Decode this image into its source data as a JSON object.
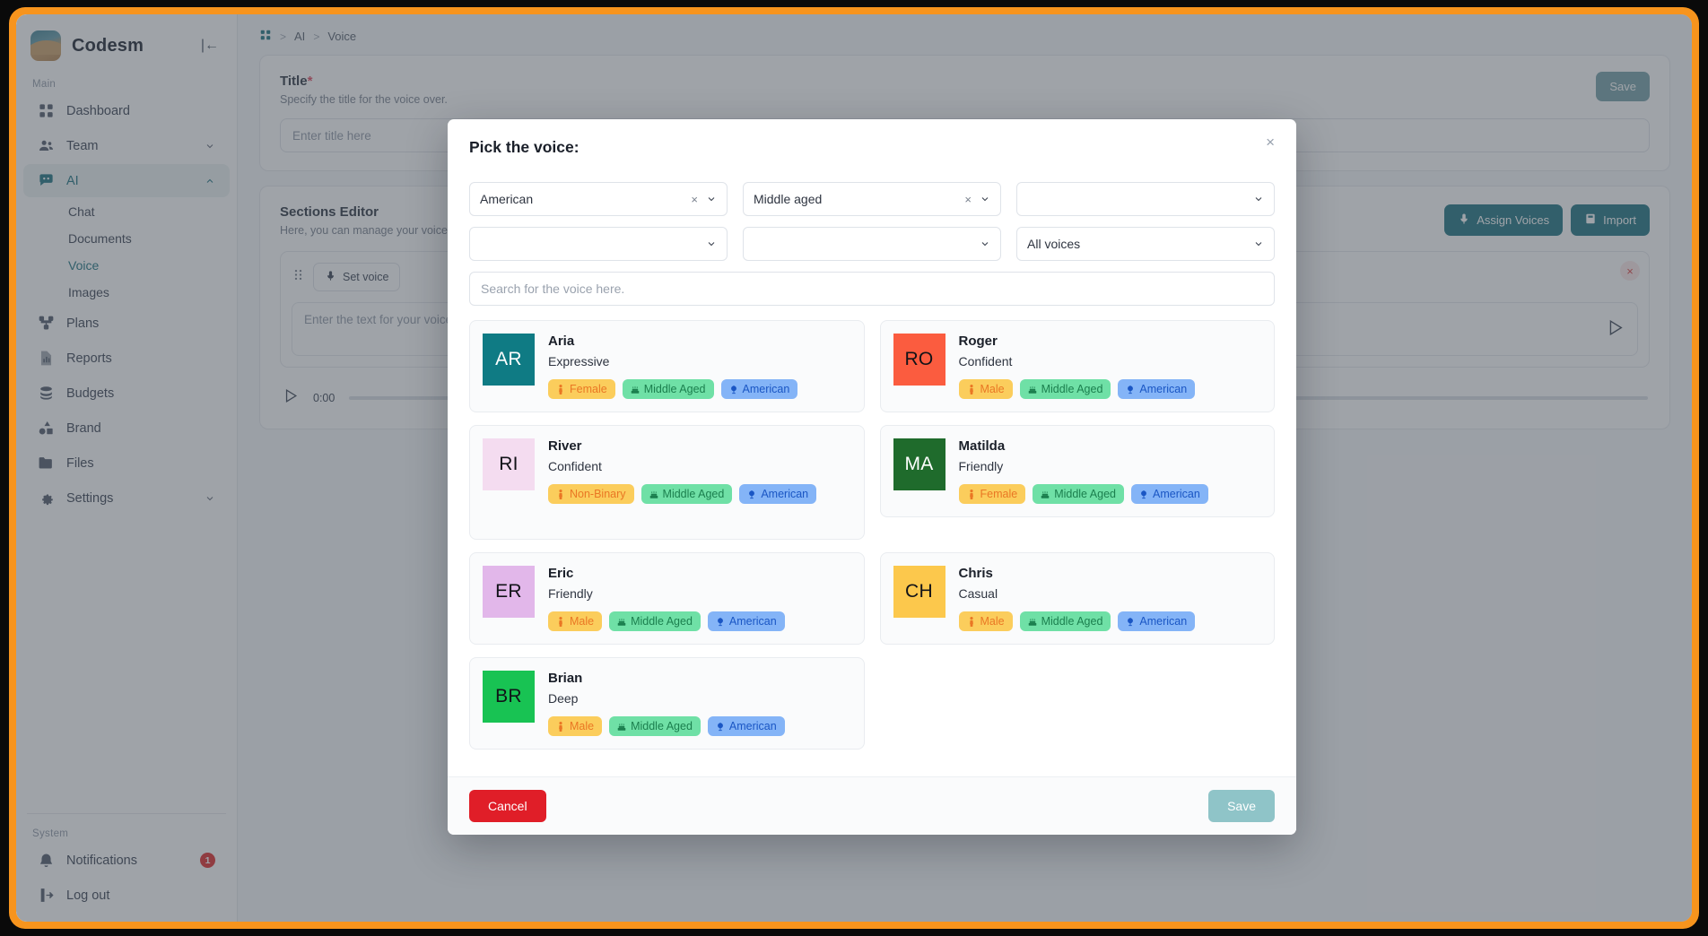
{
  "colors": {
    "frame_orange": "#f7941d",
    "brand_teal": "#2e7d8a",
    "danger_red": "#e01e28",
    "tag_gender_bg": "#fbcd5c",
    "tag_gender_fg": "#ea7724",
    "tag_age_bg": "#6fe0a6",
    "tag_age_fg": "#1b7f4e",
    "tag_accent_bg": "#84b4f7",
    "tag_accent_fg": "#1a56c4"
  },
  "sidebar": {
    "brand": "Codesm",
    "collapse_icon": "collapse-panel-icon",
    "section_main": "Main",
    "section_system": "System",
    "items": [
      {
        "label": "Dashboard",
        "icon": "dashboard-icon",
        "expandable": false
      },
      {
        "label": "Team",
        "icon": "team-icon",
        "expandable": true
      },
      {
        "label": "AI",
        "icon": "chat-ai-icon",
        "expandable": true,
        "expanded": true,
        "active": true
      },
      {
        "label": "Plans",
        "icon": "plans-icon",
        "expandable": false
      },
      {
        "label": "Reports",
        "icon": "reports-icon",
        "expandable": false
      },
      {
        "label": "Budgets",
        "icon": "budgets-icon",
        "expandable": false
      },
      {
        "label": "Brand",
        "icon": "brand-icon",
        "expandable": false
      },
      {
        "label": "Files",
        "icon": "files-icon",
        "expandable": false
      },
      {
        "label": "Settings",
        "icon": "gear-icon",
        "expandable": true
      }
    ],
    "ai_children": [
      {
        "label": "Chat",
        "current": false
      },
      {
        "label": "Documents",
        "current": false
      },
      {
        "label": "Voice",
        "current": true
      },
      {
        "label": "Images",
        "current": false
      }
    ],
    "system_items": [
      {
        "label": "Notifications",
        "icon": "bell-icon",
        "badge": "1"
      },
      {
        "label": "Log out",
        "icon": "logout-icon",
        "badge": ""
      }
    ]
  },
  "breadcrumb": {
    "home_icon": "dashboard-icon",
    "items": [
      "AI",
      "Voice"
    ],
    "separator": ">"
  },
  "main": {
    "save_label": "Save",
    "title_label": "Title",
    "title_required_mark": "*",
    "title_hint": "Specify the title for the voice over.",
    "title_placeholder": "Enter title here",
    "sections_label": "Sections Editor",
    "sections_hint": "Here, you can manage your voice over sections.",
    "assign_voices_label": "Assign Voices",
    "assign_voices_icon": "microphone-icon",
    "import_label": "Import",
    "import_icon": "import-file-icon",
    "set_voice_label": "Set voice",
    "set_voice_icon": "microphone-icon",
    "grip_icon": "drag-grip-icon",
    "row_close_icon": "close-icon",
    "text_placeholder": "Enter the text for your voice over here.",
    "audio_time": "0:00",
    "play_icon": "play-icon"
  },
  "modal": {
    "title": "Pick the voice:",
    "close_icon": "close-icon",
    "filters": [
      {
        "name": "accent-filter",
        "value": "American",
        "clearable": true,
        "clear_glyph": "×"
      },
      {
        "name": "age-filter",
        "value": "Middle aged",
        "clearable": true,
        "clear_glyph": "×"
      },
      {
        "name": "gender-filter",
        "value": "",
        "clearable": false,
        "clear_glyph": ""
      },
      {
        "name": "use-case-filter",
        "value": "",
        "clearable": false,
        "clear_glyph": ""
      },
      {
        "name": "language-filter",
        "value": "",
        "clearable": false,
        "clear_glyph": ""
      },
      {
        "name": "library-filter",
        "value": "All voices",
        "clearable": false,
        "clear_glyph": ""
      }
    ],
    "search_placeholder": "Search for the voice here.",
    "search_value": "",
    "voices": [
      {
        "name": "Aria",
        "style": "Expressive",
        "initials": "AR",
        "avatar_bg": "#0f7b84",
        "avatar_fg": "#ffffff",
        "tags": [
          {
            "kind": "gender",
            "label": "Female",
            "icon": "person-icon"
          },
          {
            "kind": "age",
            "label": "Middle Aged",
            "icon": "age-icon"
          },
          {
            "kind": "accent",
            "label": "American",
            "icon": "globe-icon"
          }
        ]
      },
      {
        "name": "Roger",
        "style": "Confident",
        "initials": "RO",
        "avatar_bg": "#fb5c3f",
        "avatar_fg": "#111318",
        "tags": [
          {
            "kind": "gender",
            "label": "Male",
            "icon": "person-icon"
          },
          {
            "kind": "age",
            "label": "Middle Aged",
            "icon": "age-icon"
          },
          {
            "kind": "accent",
            "label": "American",
            "icon": "globe-icon"
          }
        ]
      },
      {
        "name": "River",
        "style": "Confident",
        "initials": "RI",
        "avatar_bg": "#f4dcf0",
        "avatar_fg": "#111318",
        "tags": [
          {
            "kind": "gender",
            "label": "Non-Binary",
            "icon": "person-icon"
          },
          {
            "kind": "age",
            "label": "Middle Aged",
            "icon": "age-icon"
          },
          {
            "kind": "accent",
            "label": "American",
            "icon": "globe-icon"
          }
        ]
      },
      {
        "name": "Matilda",
        "style": "Friendly",
        "initials": "MA",
        "avatar_bg": "#1f6b2c",
        "avatar_fg": "#ffffff",
        "tags": [
          {
            "kind": "gender",
            "label": "Female",
            "icon": "person-icon"
          },
          {
            "kind": "age",
            "label": "Middle Aged",
            "icon": "age-icon"
          },
          {
            "kind": "accent",
            "label": "American",
            "icon": "globe-icon"
          }
        ]
      },
      {
        "name": "Eric",
        "style": "Friendly",
        "initials": "ER",
        "avatar_bg": "#e2b7ea",
        "avatar_fg": "#111318",
        "tags": [
          {
            "kind": "gender",
            "label": "Male",
            "icon": "person-icon"
          },
          {
            "kind": "age",
            "label": "Middle Aged",
            "icon": "age-icon"
          },
          {
            "kind": "accent",
            "label": "American",
            "icon": "globe-icon"
          }
        ]
      },
      {
        "name": "Chris",
        "style": "Casual",
        "initials": "CH",
        "avatar_bg": "#fcc84c",
        "avatar_fg": "#111318",
        "tags": [
          {
            "kind": "gender",
            "label": "Male",
            "icon": "person-icon"
          },
          {
            "kind": "age",
            "label": "Middle Aged",
            "icon": "age-icon"
          },
          {
            "kind": "accent",
            "label": "American",
            "icon": "globe-icon"
          }
        ]
      },
      {
        "name": "Brian",
        "style": "Deep",
        "initials": "BR",
        "avatar_bg": "#18c353",
        "avatar_fg": "#111318",
        "tags": [
          {
            "kind": "gender",
            "label": "Male",
            "icon": "person-icon"
          },
          {
            "kind": "age",
            "label": "Middle Aged",
            "icon": "age-icon"
          },
          {
            "kind": "accent",
            "label": "American",
            "icon": "globe-icon"
          }
        ]
      }
    ],
    "cancel_label": "Cancel",
    "save_label": "Save"
  }
}
